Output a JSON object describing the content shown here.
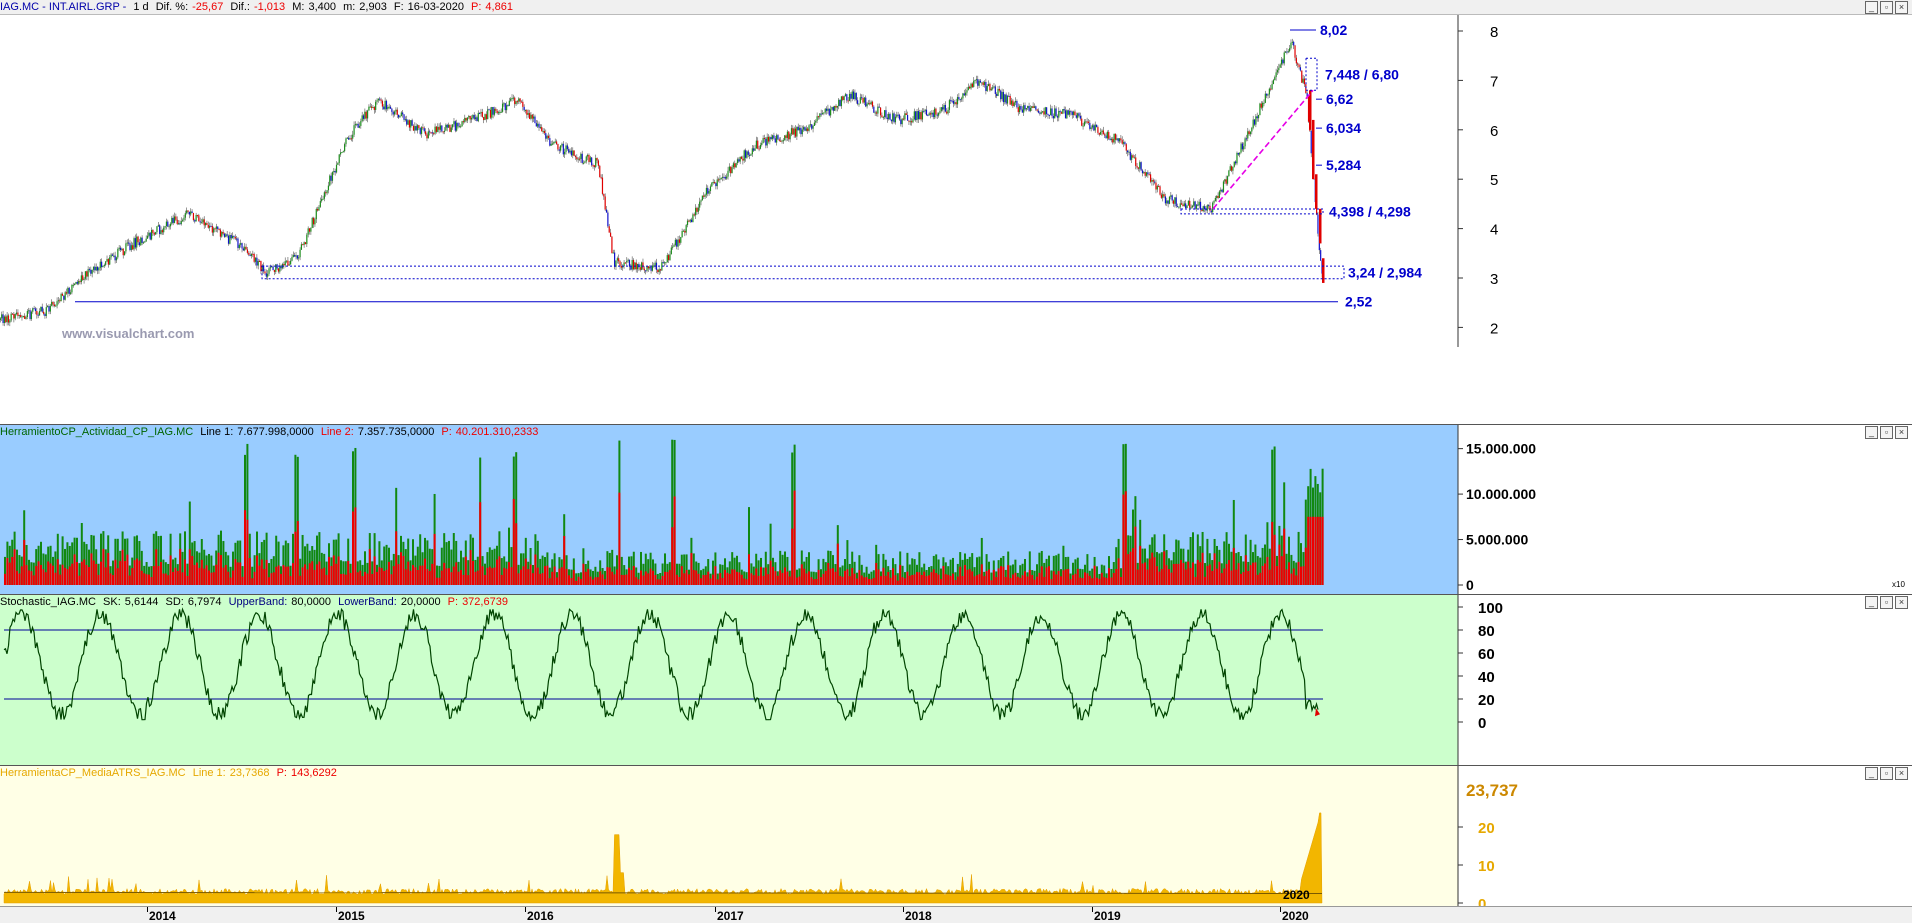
{
  "colors": {
    "price_bg": "#ffffff",
    "activity_bg": "#99ccff",
    "stoch_bg": "#ccffcc",
    "atr_bg": "#ffffe6",
    "annot": "#0000cc",
    "bull": "#1a8c1a",
    "bear": "#e00000",
    "stoch_line": "#004400",
    "atr_fill": "#f2b600"
  },
  "price_panel": {
    "symbol": "IAG.MC - INT.AIRL.GRP -",
    "tf": "1 d",
    "dif_pct_label": "Dif. %:",
    "dif_pct": "-25,67",
    "dif_label": "Dif.:",
    "dif": "-1,013",
    "max_label": "M:",
    "max": "3,400",
    "min_label": "m:",
    "min": "2,903",
    "date_label": "F:",
    "date": "16-03-2020",
    "close_label": "P:",
    "close": "4,861",
    "watermark": "www.visualchart.com",
    "yticks": [
      "8",
      "7",
      "6",
      "5",
      "4",
      "3",
      "2"
    ],
    "levels": [
      {
        "label": "8,02",
        "value": 8.02
      },
      {
        "label": "7,448 / 6,80",
        "value": 7.12
      },
      {
        "label": "6,62",
        "value": 6.62
      },
      {
        "label": "6,034",
        "value": 6.034
      },
      {
        "label": "5,284",
        "value": 5.284
      },
      {
        "label": "4,398 / 4,298",
        "value": 4.35
      },
      {
        "label": "3,24 / 2,984",
        "value": 3.11
      },
      {
        "label": "2,52",
        "value": 2.52
      }
    ]
  },
  "activity_panel": {
    "name": "HerramientoCP_Actividad_CP_IAG.MC",
    "l1_label": "Line 1:",
    "l1": "7.677.998,0000",
    "l2_label": "Line 2:",
    "l2": "7.357.735,0000",
    "p_label": "P:",
    "p": "40.201.310,2333",
    "yticks": [
      "15.000.000",
      "10.000.000",
      "5.000.000",
      "0"
    ],
    "scale": "x10"
  },
  "stoch_panel": {
    "name": "Stochastic_IAG.MC",
    "sk_label": "SK:",
    "sk": "5,6144",
    "sd_label": "SD:",
    "sd": "6,7974",
    "ub_label": "UpperBand:",
    "ub": "80,0000",
    "lb_label": "LowerBand:",
    "lb": "20,0000",
    "p_label": "P:",
    "p": "372,6739",
    "yticks": [
      "100",
      "80",
      "60",
      "40",
      "20",
      "0"
    ]
  },
  "atr_panel": {
    "name": "HerramientaCP_MediaATRS_IAG.MC",
    "l1_label": "Line 1:",
    "l1": "23,7368",
    "p_label": "P:",
    "p": "143,6292",
    "last": "23,737",
    "yticks": [
      "20",
      "10",
      "0"
    ],
    "inner_year": "2020"
  },
  "x_axis": {
    "years": [
      "2014",
      "2015",
      "2016",
      "2017",
      "2018",
      "2019",
      "2020"
    ]
  },
  "chart_data": {
    "type": "candlestick",
    "title": "IAG.MC - INT.AIRL.GRP - 1 d",
    "x_range": [
      "2013-03",
      "2020-03-16"
    ],
    "y_range": [
      1.7,
      8.3
    ],
    "price_path": [
      {
        "date": "2013-03",
        "close": 2.15
      },
      {
        "date": "2013-06",
        "close": 2.35
      },
      {
        "date": "2013-09",
        "close": 3.2
      },
      {
        "date": "2013-12",
        "close": 3.8
      },
      {
        "date": "2014-03",
        "close": 4.3
      },
      {
        "date": "2014-06",
        "close": 3.7
      },
      {
        "date": "2014-08",
        "close": 3.1
      },
      {
        "date": "2014-10",
        "close": 3.5
      },
      {
        "date": "2015-01",
        "close": 5.8
      },
      {
        "date": "2015-03",
        "close": 6.6
      },
      {
        "date": "2015-06",
        "close": 5.9
      },
      {
        "date": "2015-09",
        "close": 6.2
      },
      {
        "date": "2015-12",
        "close": 6.6
      },
      {
        "date": "2016-02",
        "close": 5.7
      },
      {
        "date": "2016-05",
        "close": 5.3
      },
      {
        "date": "2016-06",
        "close": 3.3
      },
      {
        "date": "2016-09",
        "close": 3.2
      },
      {
        "date": "2016-12",
        "close": 4.8
      },
      {
        "date": "2017-03",
        "close": 5.7
      },
      {
        "date": "2017-06",
        "close": 6.0
      },
      {
        "date": "2017-09",
        "close": 6.7
      },
      {
        "date": "2017-12",
        "close": 6.2
      },
      {
        "date": "2018-03",
        "close": 6.4
      },
      {
        "date": "2018-05",
        "close": 7.0
      },
      {
        "date": "2018-08",
        "close": 6.4
      },
      {
        "date": "2018-11",
        "close": 6.3
      },
      {
        "date": "2019-02",
        "close": 5.8
      },
      {
        "date": "2019-05",
        "close": 4.6
      },
      {
        "date": "2019-08",
        "close": 4.4
      },
      {
        "date": "2019-11",
        "close": 6.4
      },
      {
        "date": "2020-01",
        "close": 7.8
      },
      {
        "date": "2020-02",
        "close": 6.7
      },
      {
        "date": "2020-03-16",
        "close": 2.9
      }
    ],
    "annotations": [
      8.02,
      7.448,
      6.8,
      6.62,
      6.034,
      5.284,
      4.398,
      4.298,
      3.24,
      2.984,
      2.52
    ],
    "subcharts": [
      {
        "name": "Actividad_CP",
        "type": "bar",
        "ylim": [
          0,
          17000000
        ]
      },
      {
        "name": "Stochastic",
        "type": "line",
        "ylim": [
          0,
          100
        ],
        "bands": [
          20,
          80
        ]
      },
      {
        "name": "MediaATRS",
        "type": "area",
        "ylim": [
          0,
          26
        ]
      }
    ]
  }
}
